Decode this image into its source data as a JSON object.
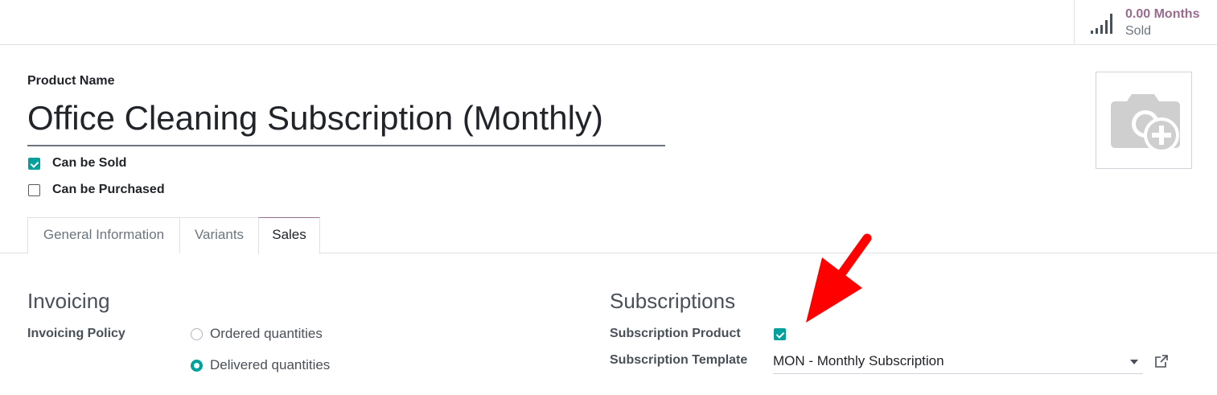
{
  "stat_button": {
    "value": "0.00 Months",
    "label": "Sold",
    "icon": "signal-bars-icon",
    "value_color": "#9a6b8e"
  },
  "product": {
    "name_label": "Product Name",
    "name": "Office Cleaning Subscription (Monthly)",
    "photo_icon": "camera-plus-icon"
  },
  "options": {
    "can_be_sold": {
      "label": "Can be Sold",
      "checked": true
    },
    "can_be_purchased": {
      "label": "Can be Purchased",
      "checked": false
    }
  },
  "tabs": [
    {
      "label": "General Information",
      "active": false
    },
    {
      "label": "Variants",
      "active": false
    },
    {
      "label": "Sales",
      "active": true
    }
  ],
  "invoicing": {
    "title": "Invoicing",
    "policy_label": "Invoicing Policy",
    "options": [
      {
        "label": "Ordered quantities",
        "selected": false
      },
      {
        "label": "Delivered quantities",
        "selected": true
      }
    ]
  },
  "subscriptions": {
    "title": "Subscriptions",
    "product_label": "Subscription Product",
    "product_checked": true,
    "template_label": "Subscription Template",
    "template_value": "MON - Monthly Subscription",
    "external_link_icon": "external-link-icon"
  },
  "colors": {
    "accent": "#00a09d",
    "brand": "#9a6b8e",
    "annotation_arrow": "#ff0000"
  }
}
